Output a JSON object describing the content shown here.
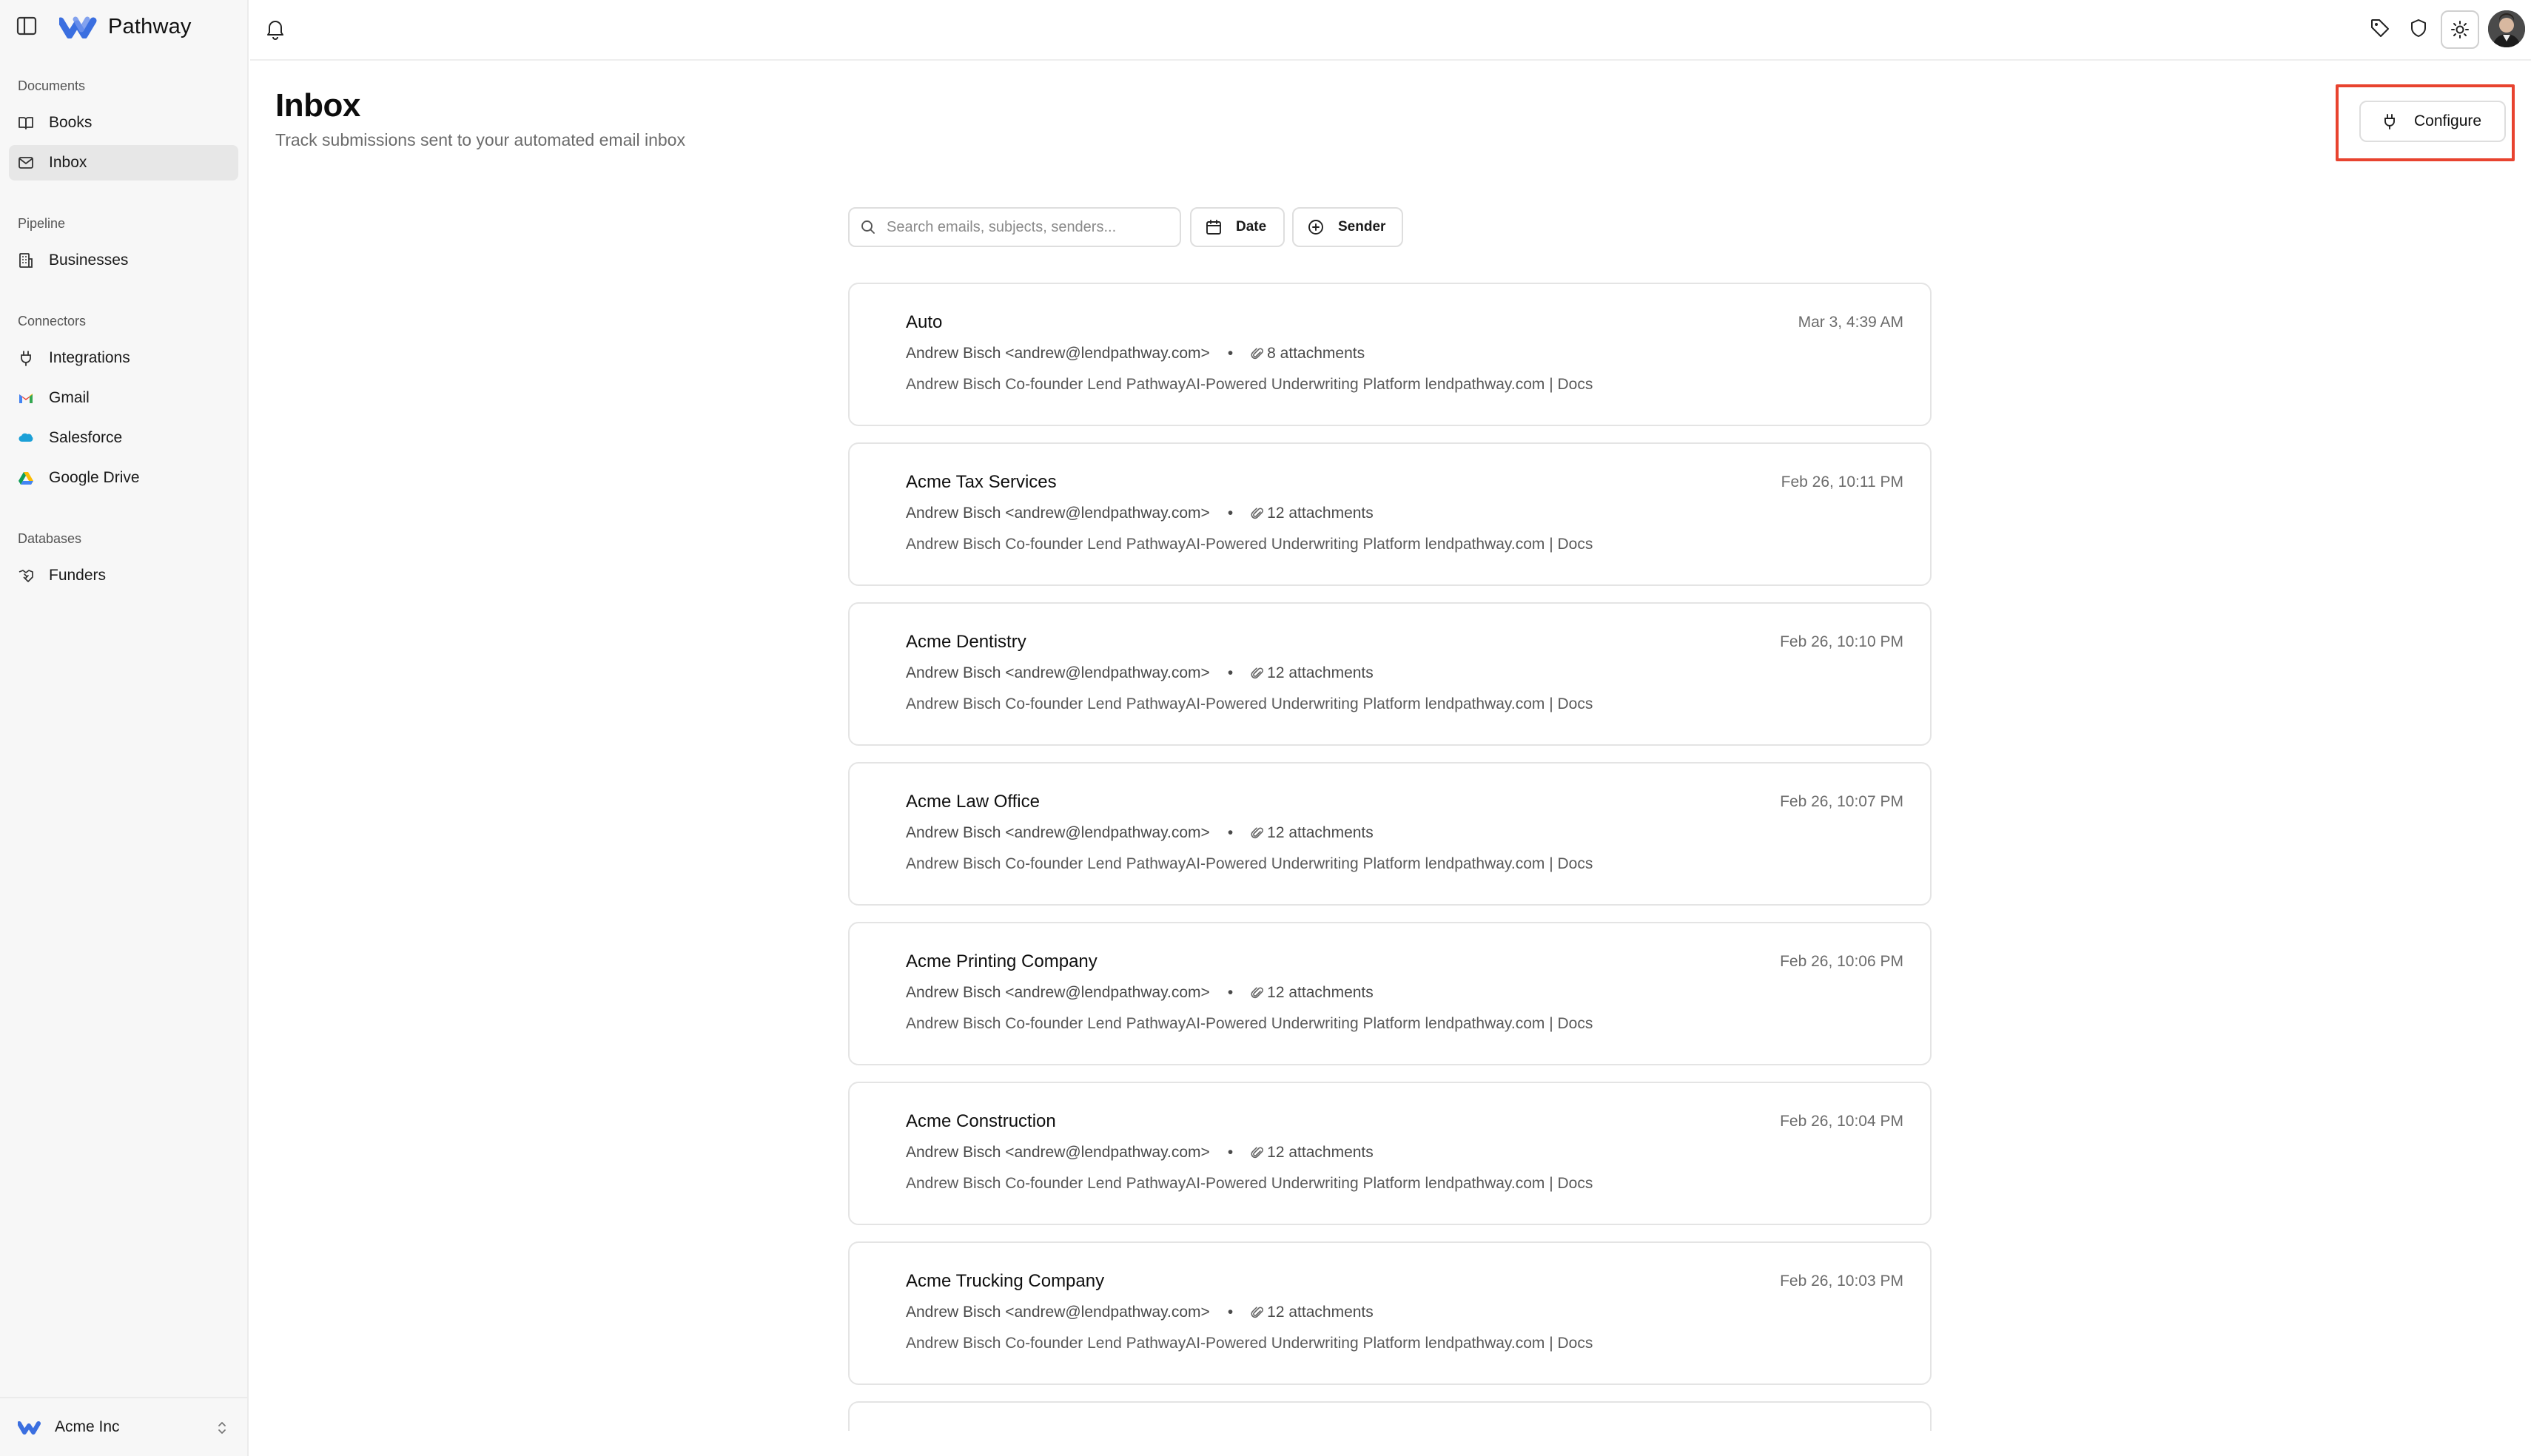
{
  "app": {
    "name": "Pathway"
  },
  "sidebar": {
    "sections": [
      {
        "heading": "Documents",
        "items": [
          {
            "label": "Books",
            "icon": "book-icon"
          },
          {
            "label": "Inbox",
            "icon": "mail-icon",
            "active": true
          }
        ]
      },
      {
        "heading": "Pipeline",
        "items": [
          {
            "label": "Businesses",
            "icon": "building-icon"
          }
        ]
      },
      {
        "heading": "Connectors",
        "items": [
          {
            "label": "Integrations",
            "icon": "plug-icon"
          },
          {
            "label": "Gmail",
            "icon": "gmail-icon"
          },
          {
            "label": "Salesforce",
            "icon": "salesforce-icon"
          },
          {
            "label": "Google Drive",
            "icon": "google-drive-icon"
          }
        ]
      },
      {
        "heading": "Databases",
        "items": [
          {
            "label": "Funders",
            "icon": "handshake-icon"
          }
        ]
      }
    ],
    "org": {
      "name": "Acme Inc"
    }
  },
  "page": {
    "title": "Inbox",
    "subtitle": "Track submissions sent to your automated email inbox",
    "configure_label": "Configure"
  },
  "filters": {
    "search_placeholder": "Search emails, subjects, senders...",
    "date_label": "Date",
    "sender_label": "Sender"
  },
  "emails": [
    {
      "subject": "Auto",
      "sender": "Andrew Bisch <andrew@lendpathway.com>",
      "attachments": "8 attachments",
      "date": "Mar 3, 4:39 AM",
      "preview": "Andrew Bisch Co-founder Lend PathwayAI-Powered Underwriting Platform lendpathway.com | Docs"
    },
    {
      "subject": "Acme Tax Services",
      "sender": "Andrew Bisch <andrew@lendpathway.com>",
      "attachments": "12 attachments",
      "date": "Feb 26, 10:11 PM",
      "preview": "Andrew Bisch Co-founder Lend PathwayAI-Powered Underwriting Platform lendpathway.com | Docs"
    },
    {
      "subject": "Acme Dentistry",
      "sender": "Andrew Bisch <andrew@lendpathway.com>",
      "attachments": "12 attachments",
      "date": "Feb 26, 10:10 PM",
      "preview": "Andrew Bisch Co-founder Lend PathwayAI-Powered Underwriting Platform lendpathway.com | Docs"
    },
    {
      "subject": "Acme Law Office",
      "sender": "Andrew Bisch <andrew@lendpathway.com>",
      "attachments": "12 attachments",
      "date": "Feb 26, 10:07 PM",
      "preview": "Andrew Bisch Co-founder Lend PathwayAI-Powered Underwriting Platform lendpathway.com | Docs"
    },
    {
      "subject": "Acme Printing Company",
      "sender": "Andrew Bisch <andrew@lendpathway.com>",
      "attachments": "12 attachments",
      "date": "Feb 26, 10:06 PM",
      "preview": "Andrew Bisch Co-founder Lend PathwayAI-Powered Underwriting Platform lendpathway.com | Docs"
    },
    {
      "subject": "Acme Construction",
      "sender": "Andrew Bisch <andrew@lendpathway.com>",
      "attachments": "12 attachments",
      "date": "Feb 26, 10:04 PM",
      "preview": "Andrew Bisch Co-founder Lend PathwayAI-Powered Underwriting Platform lendpathway.com | Docs"
    },
    {
      "subject": "Acme Trucking Company",
      "sender": "Andrew Bisch <andrew@lendpathway.com>",
      "attachments": "12 attachments",
      "date": "Feb 26, 10:03 PM",
      "preview": "Andrew Bisch Co-founder Lend PathwayAI-Powered Underwriting Platform lendpathway.com | Docs"
    }
  ],
  "colors": {
    "highlight": "#e8432f",
    "logo_blue": "#3b6fe0",
    "sidebar_bg": "#f7f7f7",
    "active_item_bg": "#e7e7e7"
  },
  "topbar_icons": [
    "bell-icon",
    "tag-icon",
    "shield-icon",
    "sun-icon",
    "avatar"
  ]
}
